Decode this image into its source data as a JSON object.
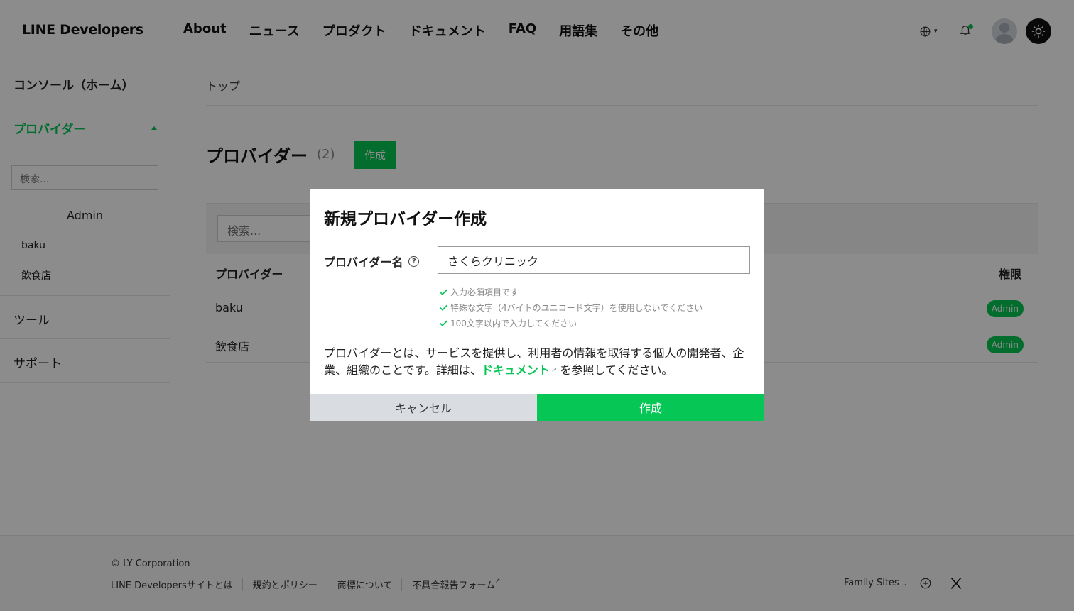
{
  "header": {
    "logo": "LINE Developers",
    "nav": [
      "About",
      "ニュース",
      "プロダクト",
      "ドキュメント",
      "FAQ",
      "用語集",
      "その他"
    ]
  },
  "sidebar": {
    "console_home": "コンソール（ホーム）",
    "providers": "プロバイダー",
    "search_placeholder": "検索...",
    "group_label": "Admin",
    "items": [
      "baku",
      "飲食店"
    ],
    "tools": "ツール",
    "support": "サポート"
  },
  "main": {
    "breadcrumb": "トップ",
    "title": "プロバイダー",
    "count": "(2)",
    "create_label": "作成",
    "table_search_placeholder": "検索...",
    "columns": [
      "プロバイダー",
      "権限"
    ],
    "rows": [
      {
        "name": "baku",
        "role": "Admin"
      },
      {
        "name": "飲食店",
        "role": "Admin"
      }
    ]
  },
  "footer": {
    "copyright": "© LY Corporation",
    "links": [
      "LINE Developersサイトとは",
      "規約とポリシー",
      "商標について",
      "不具合報告フォーム"
    ],
    "family_sites": "Family Sites"
  },
  "modal": {
    "title": "新規プロバイダー作成",
    "field_label": "プロバイダー名",
    "field_value": "さくらクリニック",
    "rules": [
      "入力必須項目です",
      "特殊な文字（4バイトのユニコード文字）を使用しないでください",
      "100文字以内で入力してください"
    ],
    "desc_before": "プロバイダーとは、サービスを提供し、利用者の情報を取得する個人の開発者、企業、組織のことです。詳細は、",
    "desc_link": "ドキュメント",
    "desc_after": "を参照してください。",
    "cancel_label": "キャンセル",
    "create_label": "作成"
  },
  "colors": {
    "accent": "#06c755",
    "overlay": "rgba(0,0,0,0.45)"
  }
}
